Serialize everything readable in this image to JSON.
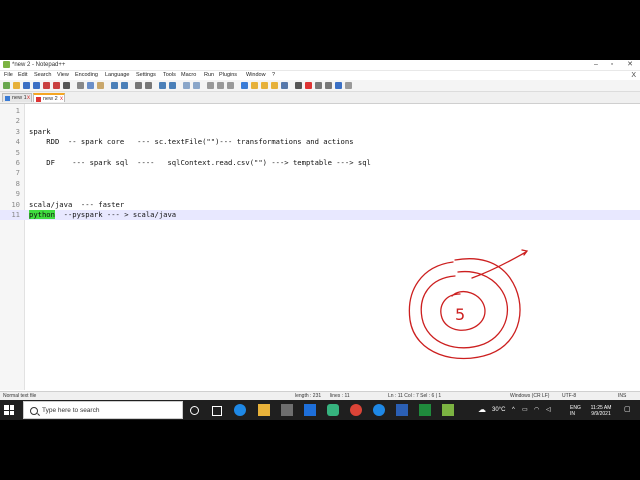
{
  "window": {
    "title": "*new 2 - Notepad++",
    "minimize": "–",
    "maximize": "▫",
    "close": "✕"
  },
  "menu": [
    "File",
    "Edit",
    "Search",
    "View",
    "Encoding",
    "Language",
    "Settings",
    "Tools",
    "Macro",
    "Run",
    "Plugins",
    "Window",
    "?"
  ],
  "menu_close": "X",
  "tabs": [
    {
      "label": "new 1",
      "active": false
    },
    {
      "label": "new 2",
      "active": true
    }
  ],
  "editor": {
    "current_line": 11,
    "lines": [
      {
        "n": "1",
        "text": ""
      },
      {
        "n": "2",
        "text": ""
      },
      {
        "n": "3",
        "text": "spark"
      },
      {
        "n": "4",
        "text": "    RDD  -- spark core   --- sc.textFile(\"\")--- transformations and actions"
      },
      {
        "n": "5",
        "text": ""
      },
      {
        "n": "6",
        "text": "    DF    --- spark sql  ----   sqlContext.read.csv(\"\") ---> temptable ---> sql"
      },
      {
        "n": "7",
        "text": ""
      },
      {
        "n": "8",
        "text": ""
      },
      {
        "n": "9",
        "text": ""
      },
      {
        "n": "10",
        "text": "scala/java  --- faster"
      },
      {
        "n": "11",
        "highlight": "python",
        "text": "  --pyspark --- > scala/java"
      }
    ],
    "annotation_text": "5"
  },
  "status": {
    "file_type": "Normal text file",
    "length": "length : 231",
    "lines": "lines : 11",
    "position": "Ln : 11   Col : 7   Sel : 6 | 1",
    "eol": "Windows (CR LF)",
    "encoding": "UTF-8",
    "mode": "INS"
  },
  "taskbar": {
    "search_placeholder": "Type here to search",
    "weather": "30°C",
    "lang_top": "ENG",
    "lang_bottom": "IN",
    "time": "11:25 AM",
    "date": "9/9/2021"
  },
  "colors": {
    "highlight": "#3fdc3f",
    "annotation": "#cc1f1f",
    "current_line": "#e8e8ff",
    "tab_accent": "#f5a623"
  }
}
